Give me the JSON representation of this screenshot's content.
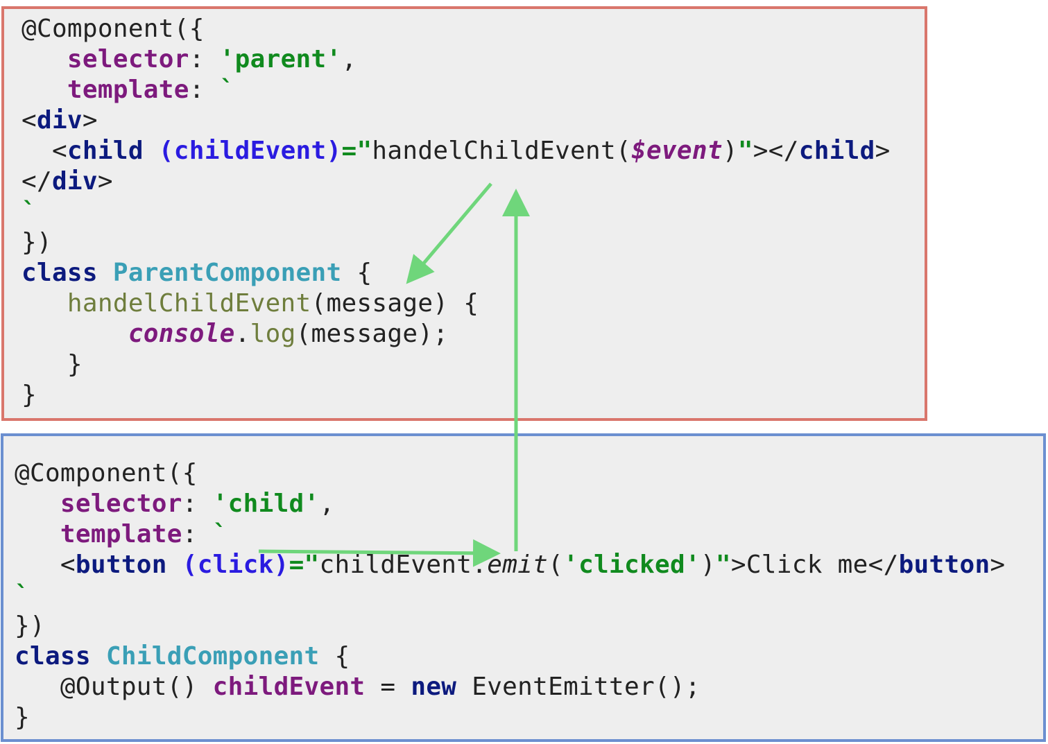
{
  "colors": {
    "parent_border": "#d9766c",
    "child_border": "#6b8fd0",
    "arrow": "#6fd67b",
    "background": "#eeeeee"
  },
  "parent_component": {
    "lines": [
      [
        {
          "t": "@Component({",
          "k": "txt"
        }
      ],
      [
        {
          "t": "   ",
          "k": "txt"
        },
        {
          "t": "selector",
          "k": "prop"
        },
        {
          "t": ": ",
          "k": "txt"
        },
        {
          "t": "'parent'",
          "k": "str"
        },
        {
          "t": ",",
          "k": "txt"
        }
      ],
      [
        {
          "t": "   ",
          "k": "txt"
        },
        {
          "t": "template",
          "k": "prop"
        },
        {
          "t": ": ",
          "k": "txt"
        },
        {
          "t": "`",
          "k": "str"
        }
      ],
      [
        {
          "t": "<",
          "k": "txt"
        },
        {
          "t": "div",
          "k": "tag"
        },
        {
          "t": ">",
          "k": "txt"
        }
      ],
      [
        {
          "t": "  <",
          "k": "txt"
        },
        {
          "t": "child",
          "k": "tag"
        },
        {
          "t": " ",
          "k": "txt"
        },
        {
          "t": "(childEvent)",
          "k": "evt"
        },
        {
          "t": "=\"",
          "k": "str"
        },
        {
          "t": "handelChildEvent(",
          "k": "txt"
        },
        {
          "t": "$event",
          "k": "var"
        },
        {
          "t": ")",
          "k": "txt"
        },
        {
          "t": "\"",
          "k": "str"
        },
        {
          "t": "></",
          "k": "txt"
        },
        {
          "t": "child",
          "k": "tag"
        },
        {
          "t": ">",
          "k": "txt"
        }
      ],
      [
        {
          "t": "</",
          "k": "txt"
        },
        {
          "t": "div",
          "k": "tag"
        },
        {
          "t": ">",
          "k": "txt"
        }
      ],
      [
        {
          "t": "`",
          "k": "str"
        }
      ],
      [
        {
          "t": "})",
          "k": "txt"
        }
      ],
      [
        {
          "t": "class",
          "k": "kw"
        },
        {
          "t": " ",
          "k": "txt"
        },
        {
          "t": "ParentComponent",
          "k": "cls"
        },
        {
          "t": " {",
          "k": "txt"
        }
      ],
      [
        {
          "t": "   ",
          "k": "txt"
        },
        {
          "t": "handelChildEvent",
          "k": "fn"
        },
        {
          "t": "(message) {",
          "k": "txt"
        }
      ],
      [
        {
          "t": "       ",
          "k": "txt"
        },
        {
          "t": "console",
          "k": "var"
        },
        {
          "t": ".",
          "k": "txt"
        },
        {
          "t": "log",
          "k": "fn"
        },
        {
          "t": "(message);",
          "k": "txt"
        }
      ],
      [
        {
          "t": "   }",
          "k": "txt"
        }
      ],
      [
        {
          "t": "}",
          "k": "txt"
        }
      ]
    ]
  },
  "child_component": {
    "lines": [
      [
        {
          "t": "@Component({",
          "k": "txt"
        }
      ],
      [
        {
          "t": "   ",
          "k": "txt"
        },
        {
          "t": "selector",
          "k": "prop"
        },
        {
          "t": ": ",
          "k": "txt"
        },
        {
          "t": "'child'",
          "k": "str"
        },
        {
          "t": ",",
          "k": "txt"
        }
      ],
      [
        {
          "t": "   ",
          "k": "txt"
        },
        {
          "t": "template",
          "k": "prop"
        },
        {
          "t": ": ",
          "k": "txt"
        },
        {
          "t": "`",
          "k": "str"
        }
      ],
      [
        {
          "t": "   <",
          "k": "txt"
        },
        {
          "t": "button",
          "k": "tag"
        },
        {
          "t": " ",
          "k": "txt"
        },
        {
          "t": "(click)",
          "k": "evt"
        },
        {
          "t": "=\"",
          "k": "str"
        },
        {
          "t": "childEvent.",
          "k": "txt"
        },
        {
          "t": "emit",
          "k": "it"
        },
        {
          "t": "(",
          "k": "txt"
        },
        {
          "t": "'clicked'",
          "k": "str"
        },
        {
          "t": ")",
          "k": "txt"
        },
        {
          "t": "\"",
          "k": "str"
        },
        {
          "t": ">Click me</",
          "k": "txt"
        },
        {
          "t": "button",
          "k": "tag"
        },
        {
          "t": ">",
          "k": "txt"
        }
      ],
      [
        {
          "t": "`",
          "k": "str"
        }
      ],
      [
        {
          "t": "})",
          "k": "txt"
        }
      ],
      [
        {
          "t": "class",
          "k": "kw"
        },
        {
          "t": " ",
          "k": "txt"
        },
        {
          "t": "ChildComponent",
          "k": "cls"
        },
        {
          "t": " {",
          "k": "txt"
        }
      ],
      [
        {
          "t": "   @Output() ",
          "k": "txt"
        },
        {
          "t": "childEvent",
          "k": "prop"
        },
        {
          "t": " = ",
          "k": "txt"
        },
        {
          "t": "new",
          "k": "kw"
        },
        {
          "t": " EventEmitter();",
          "k": "txt"
        }
      ],
      [
        {
          "t": "}",
          "k": "txt"
        }
      ]
    ]
  }
}
